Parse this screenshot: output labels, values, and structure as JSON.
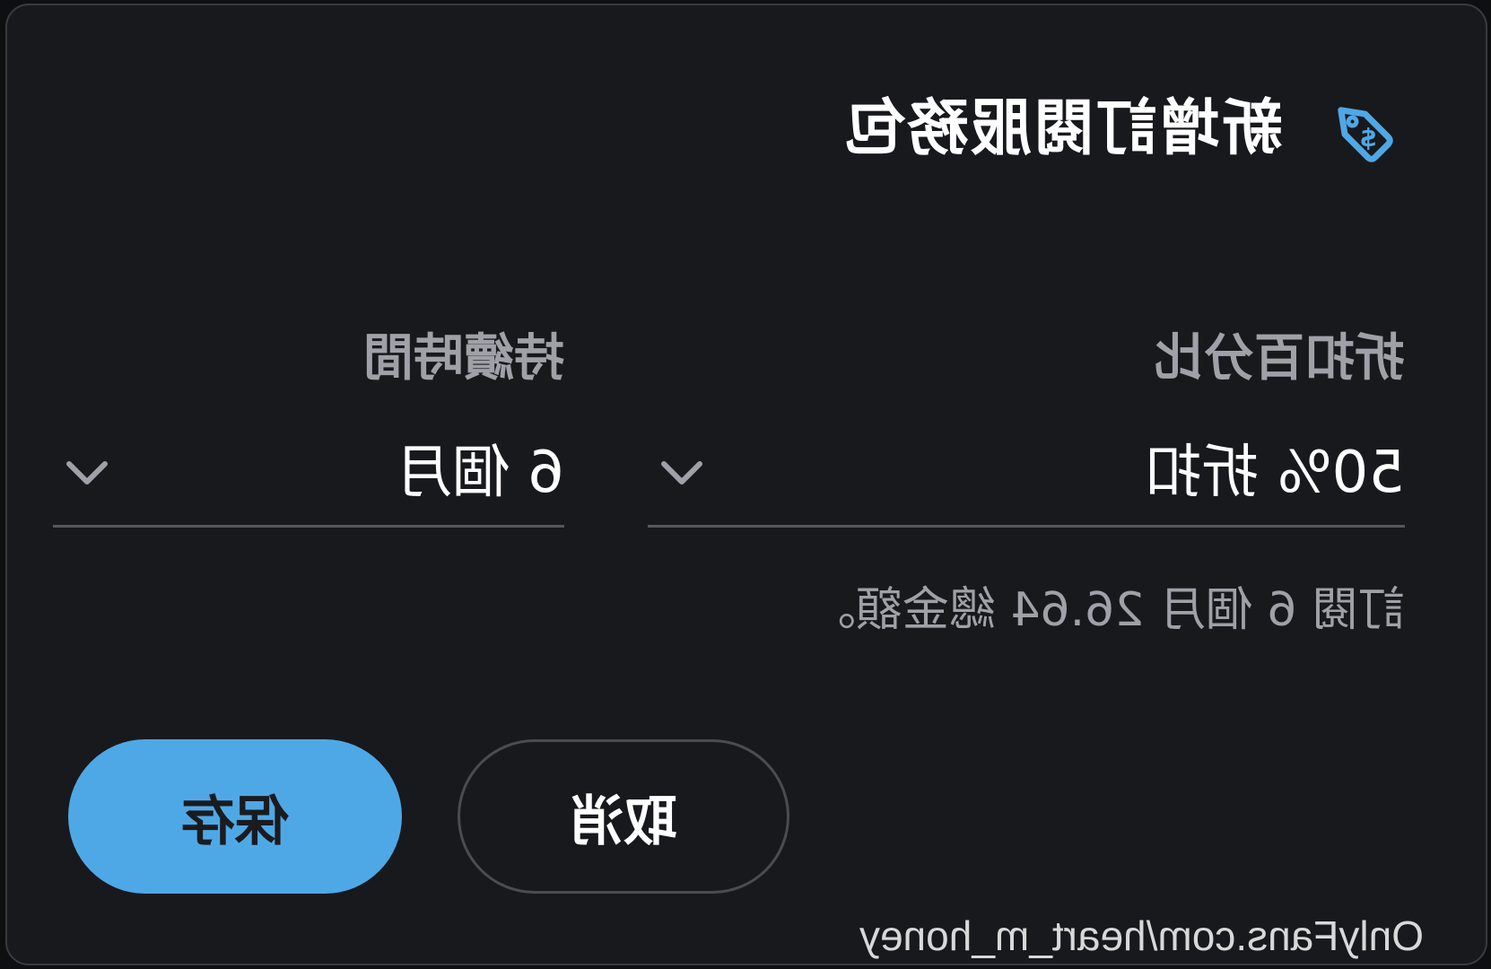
{
  "dialog": {
    "title": "新增訂閱服務包",
    "title_icon": "price-tag-dollar-icon",
    "accent_color": "#4fa8e6"
  },
  "fields": {
    "discount": {
      "label": "折扣百分比",
      "value": "50% 折扣"
    },
    "duration": {
      "label": "持續時間",
      "value": "6 個月"
    }
  },
  "summary": "訂閱 6 個月 26.64 總金額。",
  "buttons": {
    "cancel": "取消",
    "save": "保存"
  },
  "watermark": "OnlyFans.com/heart_m_honey"
}
